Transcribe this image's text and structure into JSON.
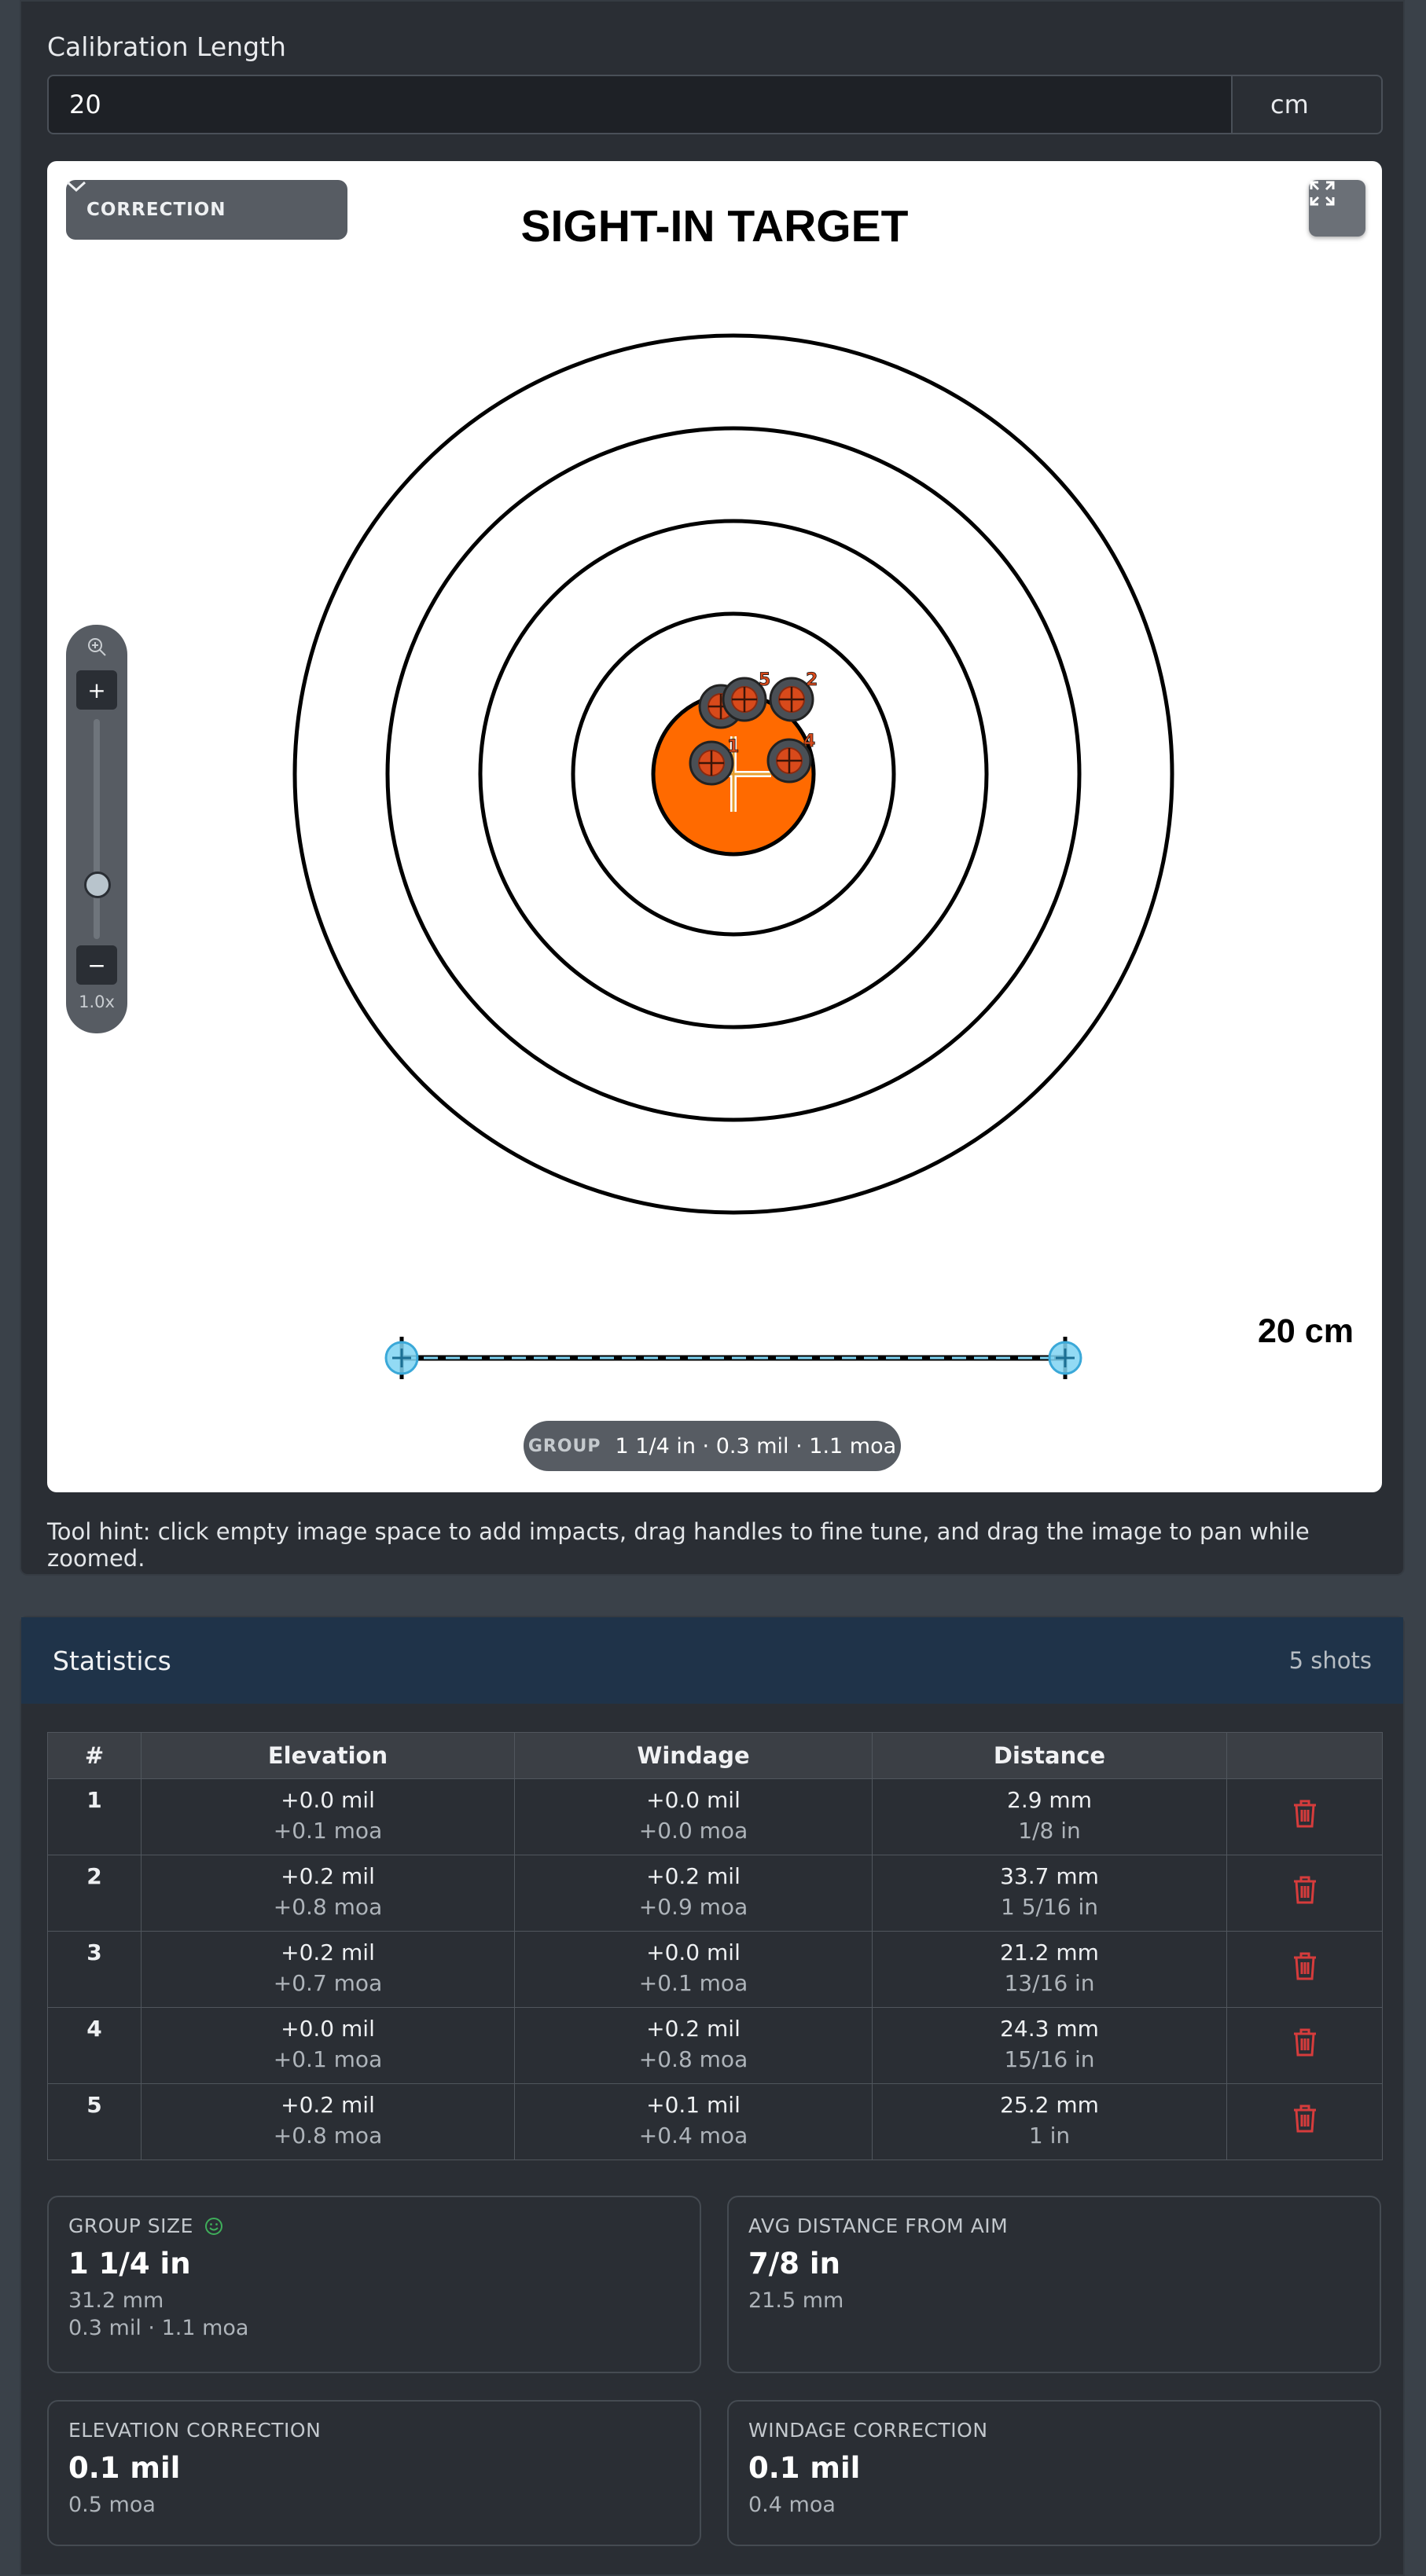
{
  "calibration": {
    "label": "Calibration Length",
    "value": "20",
    "unit": "cm"
  },
  "target": {
    "title": "SIGHT-IN TARGET",
    "mode": "CORRECTION",
    "scale_label": "20 cm",
    "zoom_plus": "+",
    "zoom_minus": "−",
    "zoom_level": "1.0x",
    "zoom_fraction": 0.15,
    "group_label": "GROUP",
    "group_value": "1 1/4 in · 0.3 mil · 1.1 moa",
    "impacts": [
      {
        "label": "1"
      },
      {
        "label": "2"
      },
      {
        "label": "3"
      },
      {
        "label": "4"
      },
      {
        "label": "5"
      }
    ],
    "colors": {
      "bullseye": "#ff6a00",
      "impact": "#d84a1b",
      "handle": "#7fd3f2"
    }
  },
  "tool_hint": "Tool hint: click empty image space to add impacts, drag handles to fine tune, and drag the image to pan while zoomed.",
  "stats": {
    "title": "Statistics",
    "count": "5 shots",
    "headers": [
      "#",
      "Elevation",
      "Windage",
      "Distance",
      ""
    ],
    "rows": [
      {
        "n": "1",
        "elev_mil": "+0.0 mil",
        "elev_moa": "+0.1 moa",
        "wind_mil": "+0.0 mil",
        "wind_moa": "+0.0 moa",
        "dist_mm": "2.9 mm",
        "dist_in": "1/8 in"
      },
      {
        "n": "2",
        "elev_mil": "+0.2 mil",
        "elev_moa": "+0.8 moa",
        "wind_mil": "+0.2 mil",
        "wind_moa": "+0.9 moa",
        "dist_mm": "33.7 mm",
        "dist_in": "1 5/16 in"
      },
      {
        "n": "3",
        "elev_mil": "+0.2 mil",
        "elev_moa": "+0.7 moa",
        "wind_mil": "+0.0 mil",
        "wind_moa": "+0.1 moa",
        "dist_mm": "21.2 mm",
        "dist_in": "13/16 in"
      },
      {
        "n": "4",
        "elev_mil": "+0.0 mil",
        "elev_moa": "+0.1 moa",
        "wind_mil": "+0.2 mil",
        "wind_moa": "+0.8 moa",
        "dist_mm": "24.3 mm",
        "dist_in": "15/16 in"
      },
      {
        "n": "5",
        "elev_mil": "+0.2 mil",
        "elev_moa": "+0.8 moa",
        "wind_mil": "+0.1 mil",
        "wind_moa": "+0.4 moa",
        "dist_mm": "25.2 mm",
        "dist_in": "1 in"
      }
    ],
    "cards": {
      "group_size": {
        "label": "GROUP SIZE",
        "value": "1 1/4 in",
        "sub1": "31.2 mm",
        "sub2": "0.3 mil · 1.1 moa"
      },
      "avg_distance": {
        "label": "AVG DISTANCE FROM AIM",
        "value": "7/8 in",
        "sub1": "21.5 mm"
      },
      "elevation": {
        "label": "ELEVATION CORRECTION",
        "value": "0.1 mil",
        "sub1": "0.5 moa"
      },
      "windage": {
        "label": "WINDAGE CORRECTION",
        "value": "0.1 mil",
        "sub1": "0.4 moa"
      }
    }
  }
}
